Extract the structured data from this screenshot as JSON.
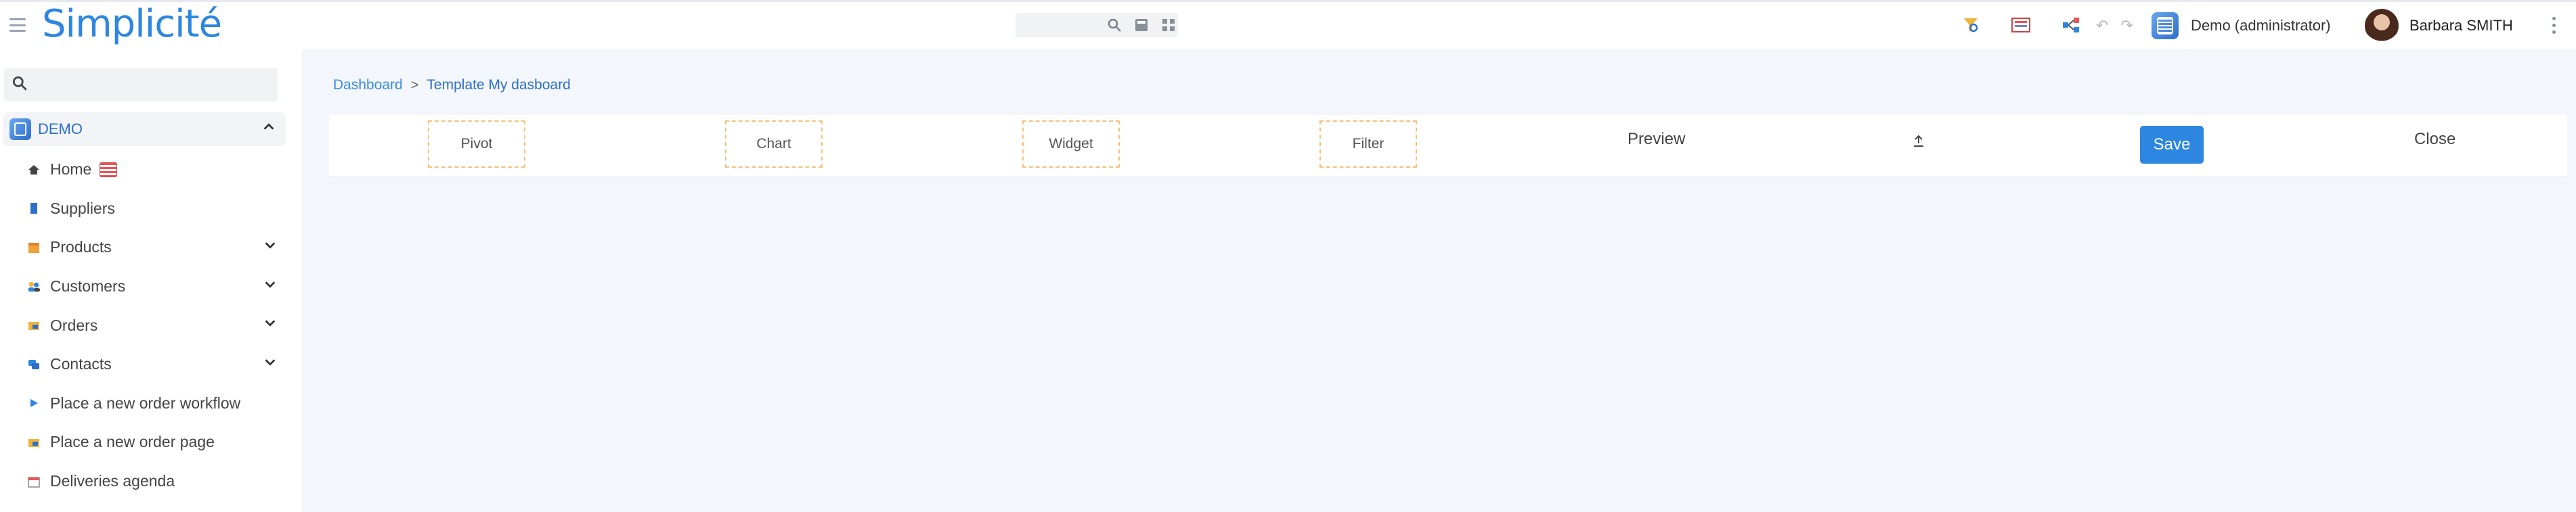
{
  "header": {
    "logo": "Simplicité",
    "app_label": "Demo (administrator)",
    "user_name": "Barbara SMITH",
    "icons": [
      "hamburger-icon",
      "search-icon",
      "calculator-icon",
      "grid-icon",
      "search-badge-icon",
      "news-icon",
      "share-icon",
      "undo-icon",
      "redo-icon",
      "app-icon",
      "kebab-icon"
    ]
  },
  "sidebar": {
    "search_placeholder": "",
    "app": {
      "label": "DEMO"
    },
    "items": [
      {
        "label": "Home",
        "icon": "home-icon",
        "expandable": false
      },
      {
        "label": "Suppliers",
        "icon": "suppliers-icon",
        "expandable": true
      },
      {
        "label": "Products",
        "icon": "box-icon",
        "expandable": true
      },
      {
        "label": "Customers",
        "icon": "people-icon",
        "expandable": true
      },
      {
        "label": "Orders",
        "icon": "folder-icon",
        "expandable": true
      },
      {
        "label": "Contacts",
        "icon": "chat-icon",
        "expandable": true
      },
      {
        "label": "Place a new order workflow",
        "icon": "play-icon",
        "expandable": false
      },
      {
        "label": "Place a new order page",
        "icon": "folder-icon",
        "expandable": false
      },
      {
        "label": "Deliveries agenda",
        "icon": "calendar-icon",
        "expandable": false
      }
    ]
  },
  "breadcrumb": {
    "root": "Dashboard",
    "separator": ">",
    "current": "Template My dasboard"
  },
  "toolbar": {
    "slots": [
      "Pivot",
      "Chart",
      "Widget",
      "Filter"
    ],
    "preview_label": "Preview",
    "upload_icon": "upload-icon",
    "save_label": "Save",
    "close_label": "Close"
  },
  "colors": {
    "accent": "#2d86e0",
    "slot_border": "#f2c27a",
    "background": "#f3f6fa"
  }
}
